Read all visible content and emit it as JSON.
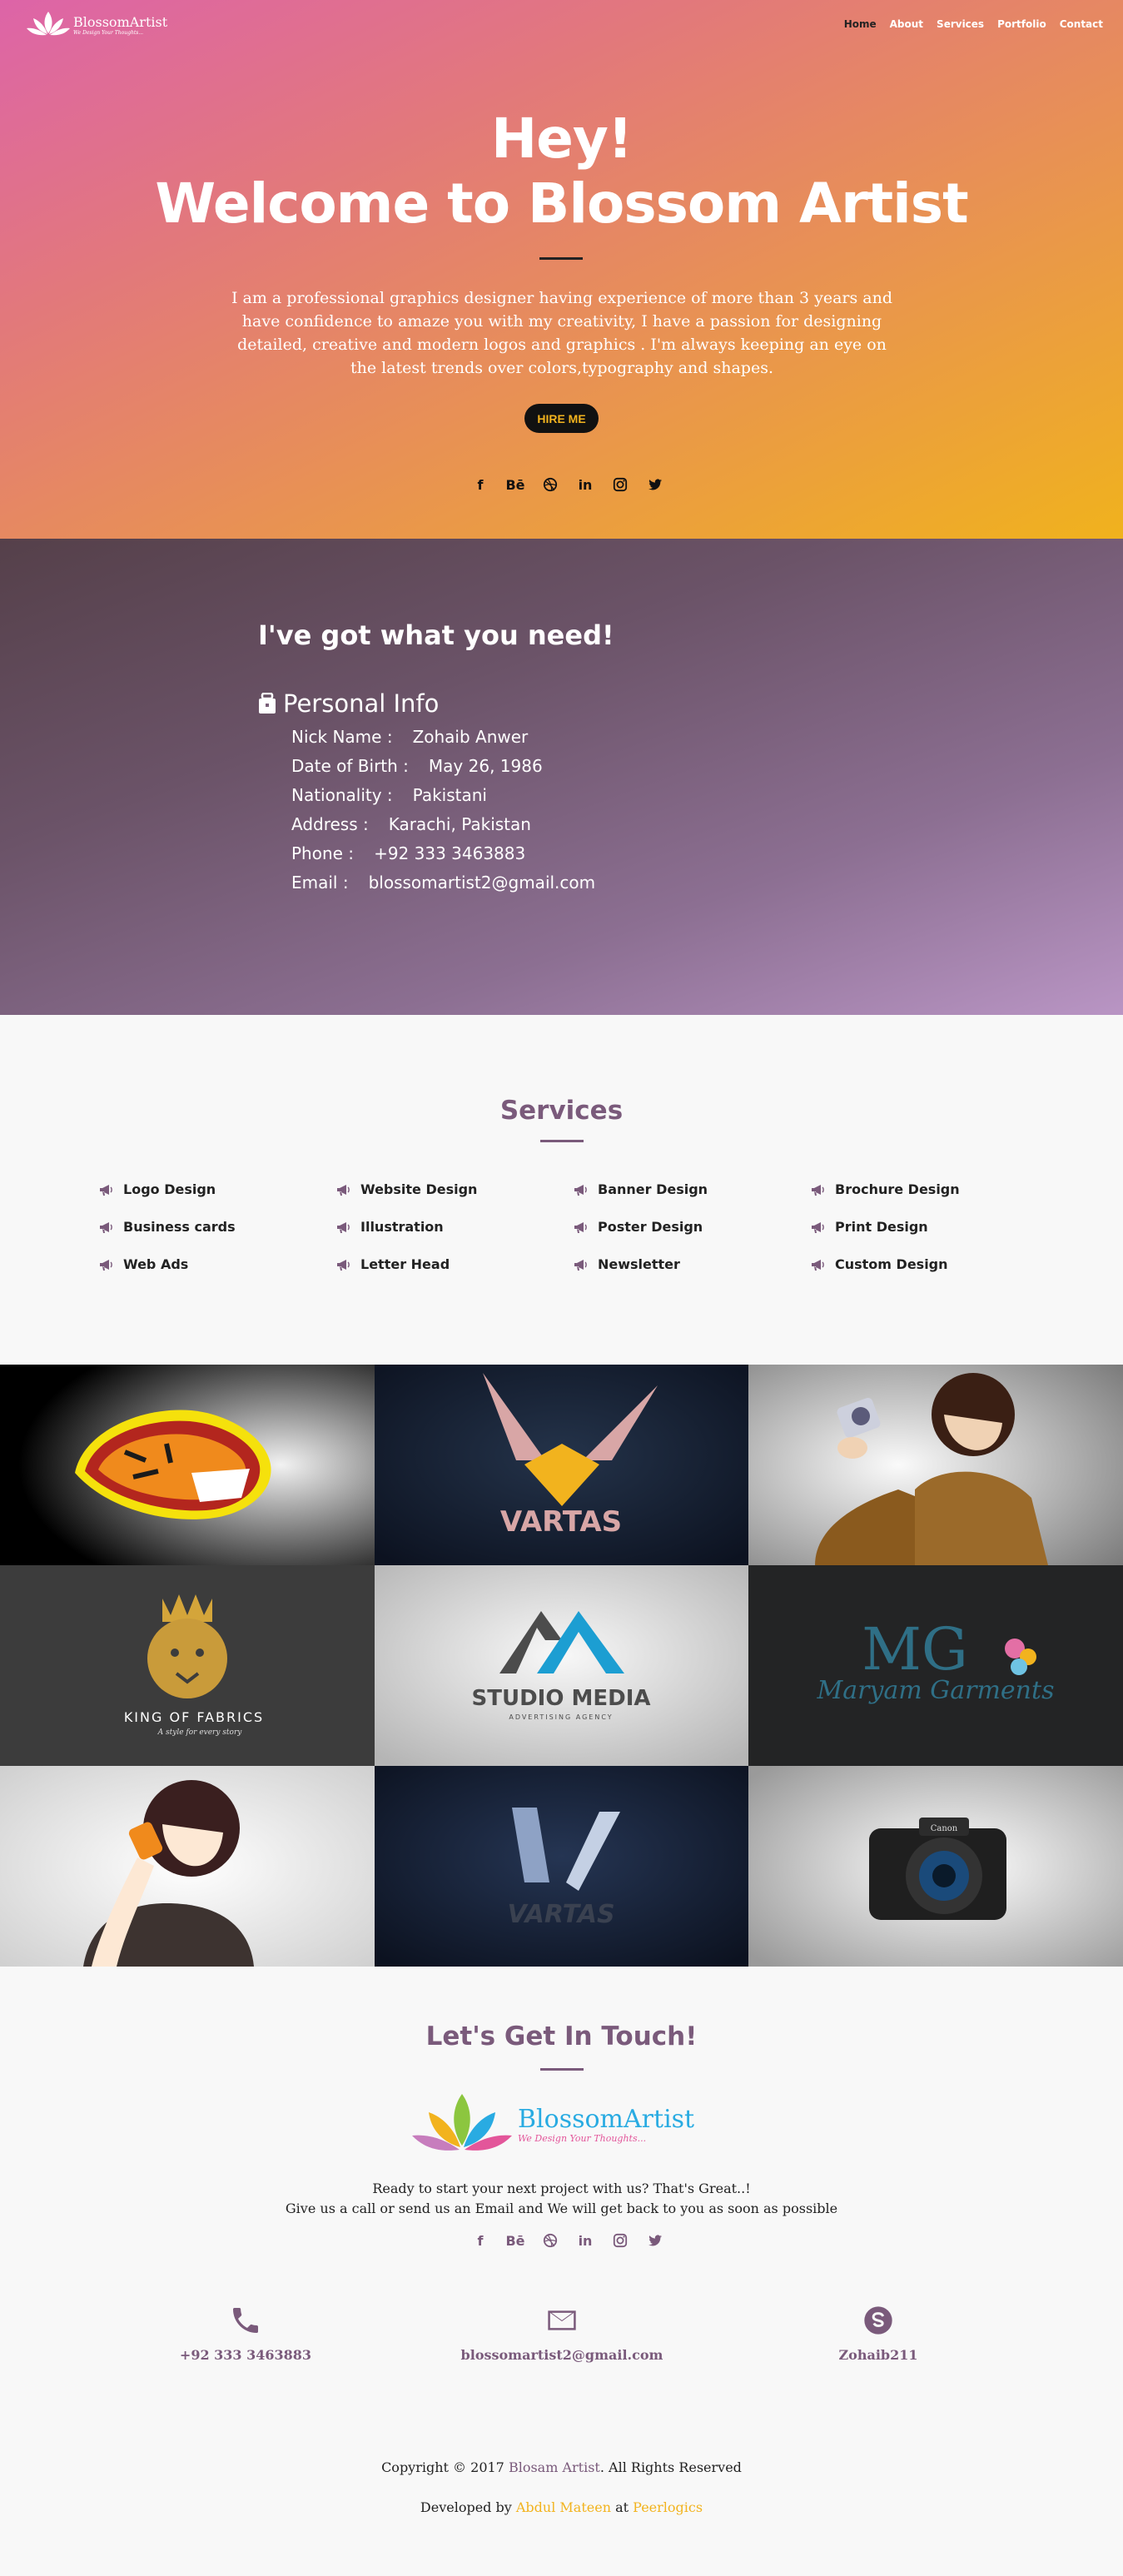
{
  "nav": {
    "brand_name": "BlossomArtist",
    "brand_tagline": "We Design Your Thoughts...",
    "items": [
      "Home",
      "About",
      "Services",
      "Portfolio",
      "Contact"
    ],
    "active": "Home"
  },
  "hero": {
    "line1": "Hey!",
    "line2": "Welcome to Blossom Artist",
    "intro": "I am a professional graphics designer having experience of more than 3 years and have confidence to amaze you with my creativity, I have a passion for designing detailed, creative and modern logos and graphics . I'm always keeping an eye on the latest trends over colors,typography and shapes.",
    "hire_label": "HIRE ME",
    "social_icons": [
      "facebook-icon",
      "behance-icon",
      "dribbble-icon",
      "linkedin-icon",
      "instagram-icon",
      "twitter-icon"
    ]
  },
  "about": {
    "heading": "I've got what you need!",
    "personal_info_title": "Personal Info",
    "fields": [
      {
        "label": "Nick Name :",
        "value": "Zohaib Anwer"
      },
      {
        "label": "Date of Birth :",
        "value": "May 26, 1986"
      },
      {
        "label": "Nationality :",
        "value": "Pakistani"
      },
      {
        "label": "Address :",
        "value": "Karachi, Pakistan"
      },
      {
        "label": "Phone :",
        "value": "+92 333 3463883"
      },
      {
        "label": "Email :",
        "value": "blossomartist2@gmail.com"
      }
    ]
  },
  "services": {
    "title": "Services",
    "items": [
      "Logo Design",
      "Website Design",
      "Banner Design",
      "Brochure Design",
      "Business cards",
      "Illustration",
      "Poster Design",
      "Print Design",
      "Web Ads",
      "Letter Head",
      "Newsletter",
      "Custom Design"
    ]
  },
  "portfolio": {
    "tiles": [
      {
        "caption": ""
      },
      {
        "caption": "VARTAS"
      },
      {
        "caption": ""
      },
      {
        "caption": "KING OF FABRICS",
        "sub": "A style for every story"
      },
      {
        "caption": "STUDIO MEDIA",
        "sub": "ADVERTISING AGENCY"
      },
      {
        "caption": "Maryam Garments",
        "mono": "MG"
      },
      {
        "caption": ""
      },
      {
        "caption": "VARTAS"
      },
      {
        "caption": "Canon"
      }
    ]
  },
  "contact": {
    "title": "Let's Get In Touch!",
    "logo_name": "BlossomArtist",
    "logo_tagline": "We Design Your Thoughts...",
    "cta_line1": "Ready to start your next project with us? That's Great..!",
    "cta_line2": "Give us a call or send us an Email and We will get back to you as soon as possible",
    "phone": "+92 333 3463883",
    "email": "blossomartist2@gmail.com",
    "skype": "Zohaib211"
  },
  "footer": {
    "copy_prefix": "Copyright © 2017 ",
    "copy_brand": "Blosam Artist",
    "copy_suffix": ". All Rights Reserved",
    "dev_prefix": "Developed by ",
    "dev_name": "Abdul Mateen",
    "dev_mid": " at ",
    "dev_company": "Peerlogics"
  },
  "colors": {
    "accent": "#7a5a7b",
    "gold": "#f2b31e"
  }
}
